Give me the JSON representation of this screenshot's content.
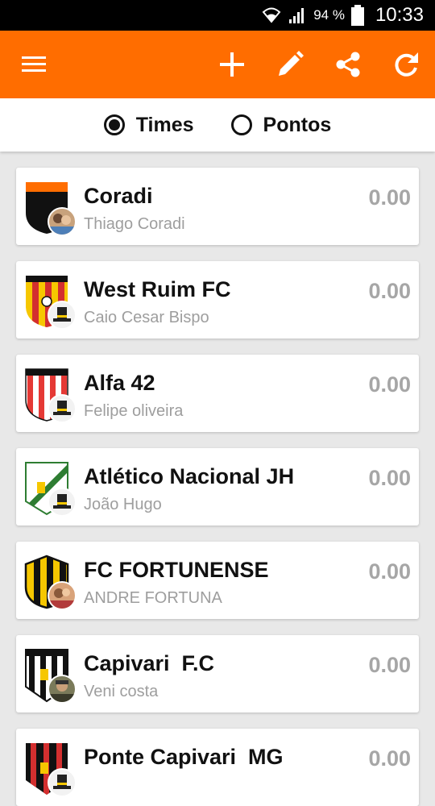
{
  "status_bar": {
    "battery_percent": "94 %",
    "time": "10:33"
  },
  "app_bar": {
    "icons": [
      "menu-icon",
      "add-icon",
      "edit-icon",
      "share-icon",
      "refresh-icon"
    ],
    "color": "#ff6d00"
  },
  "toggle": {
    "options": [
      {
        "label": "Times",
        "selected": true
      },
      {
        "label": "Pontos",
        "selected": false
      }
    ]
  },
  "teams": [
    {
      "name": "Coradi",
      "owner": "Thiago Coradi",
      "points": "0.00",
      "shield": "orange-black",
      "avatar": "photo"
    },
    {
      "name": "West Ruim FC",
      "owner": "Caio Cesar Bispo",
      "points": "0.00",
      "shield": "yellow-red-stripes",
      "avatar": "top-hat"
    },
    {
      "name": "Alfa 42",
      "owner": "Felipe oliveira",
      "points": "0.00",
      "shield": "red-white-stripes",
      "avatar": "top-hat"
    },
    {
      "name": "Atlético Nacional JH",
      "owner": "João Hugo",
      "points": "0.00",
      "shield": "white-green-diagonal",
      "avatar": "top-hat"
    },
    {
      "name": "FC FORTUNENSE",
      "owner": "ANDRE FORTUNA",
      "points": "0.00",
      "shield": "yellow-black-stripes",
      "avatar": "photo"
    },
    {
      "name": "Capivari  F.C",
      "owner": "Veni costa",
      "points": "0.00",
      "shield": "black-white-stripes",
      "avatar": "photo"
    },
    {
      "name": "Ponte Capivari  MG",
      "owner": "",
      "points": "0.00",
      "shield": "black-red-stripes",
      "avatar": "top-hat"
    }
  ]
}
